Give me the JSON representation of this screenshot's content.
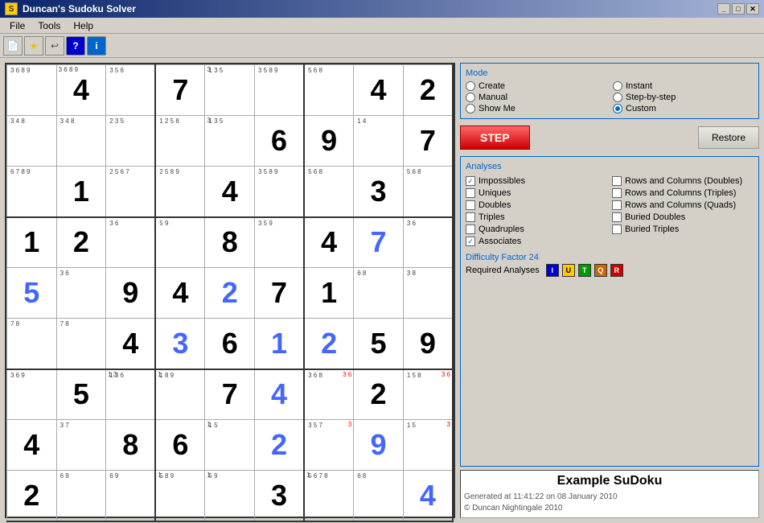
{
  "window": {
    "title": "Duncan's Sudoku Solver",
    "title_icon": "S"
  },
  "menu": {
    "items": [
      "File",
      "Tools",
      "Help"
    ]
  },
  "toolbar": {
    "buttons": [
      "new",
      "star",
      "undo",
      "help",
      "info"
    ]
  },
  "mode": {
    "label": "Mode",
    "options": [
      {
        "id": "create",
        "label": "Create",
        "checked": false
      },
      {
        "id": "instant",
        "label": "Instant",
        "checked": false
      },
      {
        "id": "manual",
        "label": "Manual",
        "checked": false
      },
      {
        "id": "stepbystep",
        "label": "Step-by-step",
        "checked": false
      },
      {
        "id": "showme",
        "label": "Show Me",
        "checked": false
      },
      {
        "id": "custom",
        "label": "Custom",
        "checked": true
      }
    ]
  },
  "buttons": {
    "step": "STEP",
    "restore": "Restore"
  },
  "analyses": {
    "label": "Analyses",
    "left": [
      {
        "id": "impossibles",
        "label": "Impossibles",
        "checked": true
      },
      {
        "id": "uniques",
        "label": "Uniques",
        "checked": false
      },
      {
        "id": "doubles",
        "label": "Doubles",
        "checked": false
      },
      {
        "id": "triples",
        "label": "Triples",
        "checked": false
      },
      {
        "id": "quadruples",
        "label": "Quadruples",
        "checked": false
      },
      {
        "id": "associates",
        "label": "Associates",
        "checked": true
      }
    ],
    "right": [
      {
        "id": "rowscol_doubles",
        "label": "Rows and Columns (Doubles)",
        "checked": false
      },
      {
        "id": "rowscol_triples",
        "label": "Rows and Columns (Triples)",
        "checked": false
      },
      {
        "id": "rowscol_quads",
        "label": "Rows and Columns (Quads)",
        "checked": false
      },
      {
        "id": "buried_doubles",
        "label": "Buried Doubles",
        "checked": false
      },
      {
        "id": "buried_triples",
        "label": "Buried Triples",
        "checked": false
      }
    ]
  },
  "difficulty": {
    "label": "Difficulty Factor 24"
  },
  "required_analyses": {
    "label": "Required Analyses",
    "badges": [
      "I",
      "U",
      "T",
      "Q",
      "R"
    ]
  },
  "example": {
    "title": "Example SuDoku",
    "subtitle": "Generated at 11:41:22 on 08 January 2010\n© Duncan Nightingale 2010"
  },
  "grid": {
    "cells": [
      [
        {
          "main": null,
          "notes": "3\n6\n8 9",
          "blue": false
        },
        {
          "main": 4,
          "notes_tl": "3\n6\n8 9",
          "blue": false
        },
        {
          "main": null,
          "notes": "3\n5 6",
          "blue": false
        },
        {
          "main": 7,
          "notes": null,
          "blue": false
        },
        {
          "main": null,
          "notes": "1\n5\n",
          "blue": false,
          "notes_tl": "3"
        },
        {
          "main": null,
          "notes": "5\n8 9",
          "blue": false,
          "notes_tl": "3"
        },
        {
          "main": null,
          "notes": "5 6\n8",
          "blue": false
        },
        {
          "main": 4,
          "notes": null,
          "blue": false
        },
        {
          "main": 2,
          "notes": null,
          "blue": false
        }
      ],
      [
        {
          "main": null,
          "notes": "3\n4\n8",
          "blue": false
        },
        {
          "main": null,
          "notes": "3\n4\n8",
          "blue": false
        },
        {
          "main": null,
          "notes": "2 3\n5\n",
          "blue": false
        },
        {
          "main": null,
          "notes": "1 2\n5\n8",
          "blue": false
        },
        {
          "main": null,
          "notes": "1\n5\n",
          "blue": false,
          "notes_tl": "3"
        },
        {
          "main": 6,
          "notes": null,
          "blue": false
        },
        {
          "main": 9,
          "notes": null,
          "blue": false
        },
        {
          "main": null,
          "notes": "1\n4",
          "blue": false
        },
        {
          "main": 7,
          "notes": null,
          "blue": false
        }
      ],
      [
        {
          "main": null,
          "notes": "6\n7 8 9",
          "blue": false
        },
        {
          "main": 1,
          "notes": null,
          "blue": false
        },
        {
          "main": null,
          "notes": "2\n5 6\n7",
          "blue": false
        },
        {
          "main": null,
          "notes": "2\n5\n8 9",
          "blue": false
        },
        {
          "main": 4,
          "notes": null,
          "blue": false
        },
        {
          "main": null,
          "notes": "5\n8 9",
          "blue": false,
          "notes_tl": "3"
        },
        {
          "main": null,
          "notes": "5 6\n8",
          "blue": false
        },
        {
          "main": 3,
          "notes": null,
          "blue": false
        },
        {
          "main": null,
          "notes": "5 6\n8",
          "blue": false
        }
      ],
      [
        {
          "main": 1,
          "notes": null,
          "blue": false
        },
        {
          "main": 2,
          "notes": null,
          "blue": false
        },
        {
          "main": null,
          "notes": "3\n6",
          "blue": false
        },
        {
          "main": null,
          "notes": "5\n",
          "blue": false
        },
        {
          "main": 8,
          "notes": null,
          "blue": false
        },
        {
          "main": null,
          "notes": "5\n9",
          "blue": false,
          "notes_tl": "3"
        },
        {
          "main": 4,
          "notes": null,
          "blue": false
        },
        {
          "main": 7,
          "notes": null,
          "blue": true
        },
        {
          "main": null,
          "notes": "3\n6",
          "blue": false
        }
      ],
      [
        {
          "main": 5,
          "notes": null,
          "blue": true
        },
        {
          "main": null,
          "notes": "3\n6",
          "blue": false
        },
        {
          "main": 9,
          "notes": null,
          "blue": false
        },
        {
          "main": 4,
          "notes": null,
          "blue": false
        },
        {
          "main": 2,
          "notes": null,
          "blue": true
        },
        {
          "main": 7,
          "notes": null,
          "blue": false
        },
        {
          "main": 1,
          "notes": null,
          "blue": false
        },
        {
          "main": null,
          "notes": "6\n8",
          "blue": false
        },
        {
          "main": null,
          "notes": "3\n8",
          "blue": false
        }
      ],
      [
        {
          "main": null,
          "notes": "7 8",
          "blue": false
        },
        {
          "main": null,
          "notes": "7 8",
          "blue": false
        },
        {
          "main": 4,
          "notes": null,
          "blue": false
        },
        {
          "main": 3,
          "notes": null,
          "blue": true
        },
        {
          "main": 6,
          "notes": null,
          "blue": false
        },
        {
          "main": 1,
          "notes": null,
          "blue": true
        },
        {
          "main": 2,
          "notes": null,
          "blue": true
        },
        {
          "main": 5,
          "notes": null,
          "blue": false
        },
        {
          "main": 9,
          "notes": null,
          "blue": false
        }
      ],
      [
        {
          "main": null,
          "notes": "3\n6\n9",
          "blue": false
        },
        {
          "main": 5,
          "notes": null,
          "blue": false
        },
        {
          "main": null,
          "notes": "1\n3\n6",
          "blue": false,
          "notes_tr": "1\n3"
        },
        {
          "main": null,
          "notes": "1\n8 9",
          "blue": false,
          "notes_tl": "1"
        },
        {
          "main": 7,
          "notes": null,
          "blue": false
        },
        {
          "main": 4,
          "notes": null,
          "blue": true
        },
        {
          "main": null,
          "notes": "3\n6\n8",
          "blue": false,
          "notes_tr": "3\n6"
        },
        {
          "main": 2,
          "notes": null,
          "blue": false
        },
        {
          "main": null,
          "notes": "1\n5\n8",
          "blue": false,
          "notes_tr": "3\n6"
        }
      ],
      [
        {
          "main": 4,
          "notes": null,
          "blue": false
        },
        {
          "main": null,
          "notes": "3\n7",
          "blue": false
        },
        {
          "main": 8,
          "notes": null,
          "blue": false
        },
        {
          "main": 6,
          "notes": null,
          "blue": false
        },
        {
          "main": null,
          "notes": "1\n5",
          "blue": false,
          "notes_tl": "1"
        },
        {
          "main": 2,
          "notes": null,
          "blue": true
        },
        {
          "main": null,
          "notes": "3\n5\n7",
          "blue": false,
          "notes_tr": "3"
        },
        {
          "main": 9,
          "notes": null,
          "blue": true
        },
        {
          "main": null,
          "notes": "1\n5",
          "blue": false,
          "notes_tr": "3"
        }
      ],
      [
        {
          "main": 2,
          "notes": null,
          "blue": false
        },
        {
          "main": null,
          "notes": "6\n9",
          "blue": false
        },
        {
          "main": null,
          "notes": "6\n9",
          "blue": false
        },
        {
          "main": null,
          "notes": "5\n8 9",
          "blue": false,
          "notes_tl": "1"
        },
        {
          "main": null,
          "notes": "5\n9",
          "blue": false,
          "notes_tl": "1"
        },
        {
          "main": 3,
          "notes": null,
          "blue": false
        },
        {
          "main": null,
          "notes": "5 6\n7 8",
          "blue": false,
          "notes_tl": "1"
        },
        {
          "main": null,
          "notes": "6\n8",
          "blue": false
        },
        {
          "main": 4,
          "notes": null,
          "blue": true
        }
      ]
    ]
  }
}
